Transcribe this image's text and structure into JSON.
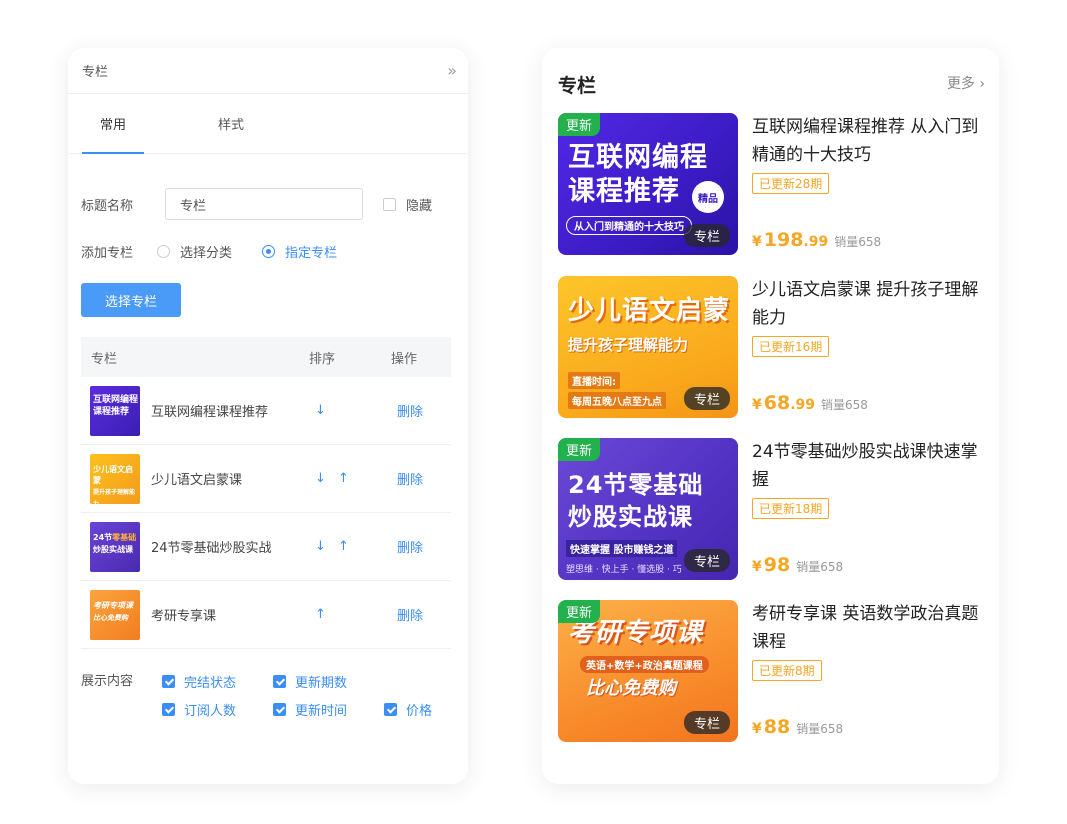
{
  "panel": {
    "title": "专栏",
    "collapse_icon": "double-chevron-right-icon",
    "tabs": [
      {
        "label": "常用",
        "active": true
      },
      {
        "label": "样式",
        "active": false
      }
    ],
    "title_field": {
      "label": "标题名称",
      "value": "专栏",
      "hide_label": "隐藏"
    },
    "add_column": {
      "label": "添加专栏",
      "options": [
        {
          "label": "选择分类",
          "selected": false
        },
        {
          "label": "指定专栏",
          "selected": true
        }
      ]
    },
    "select_button": "选择专栏",
    "table": {
      "headers": [
        "专栏",
        "排序",
        "操作"
      ],
      "rows": [
        {
          "name": "互联网编程课程推荐",
          "sort": "↓",
          "action": "删除",
          "thumb_text": "互联网编程\n课程推荐",
          "thumb_color": "#4a2bd6"
        },
        {
          "name": "少儿语文启蒙课",
          "sort": "↓ ↑",
          "action": "删除",
          "thumb_text": "少儿语文启蒙\n提升孩子理解能力",
          "thumb_color": "#f8b31a"
        },
        {
          "name": "24节零基础炒股实战",
          "sort": "↓ ↑",
          "action": "删除",
          "thumb_text": "24节零基础\n炒股实战课",
          "thumb_color": "#5a3cc7"
        },
        {
          "name": "考研专享课",
          "sort": "↑",
          "action": "删除",
          "thumb_text": "考研专项课\n比心免费购",
          "thumb_color": "#f79a2e"
        }
      ]
    },
    "display": {
      "label": "展示内容",
      "options": [
        {
          "label": "完结状态",
          "checked": true
        },
        {
          "label": "更新期数",
          "checked": true
        },
        {
          "label": "订阅人数",
          "checked": true
        },
        {
          "label": "更新时间",
          "checked": true
        },
        {
          "label": "价格",
          "checked": true
        }
      ]
    }
  },
  "preview": {
    "title": "专栏",
    "more": "更多 ›",
    "items": [
      {
        "tag_new": "更新",
        "cover_lines": [
          "互联网编程",
          "课程推荐"
        ],
        "cover_sub": "从入门到精通的十大技巧",
        "cover_badge": "精品",
        "tag_col": "专栏",
        "name": "互联网编程课程推荐 从入门到精通的十大技巧",
        "update": "已更新28期",
        "price_int": "198",
        "price_dec": ".99",
        "currency": "¥",
        "sales": "销量658"
      },
      {
        "tag_new": "",
        "cover_lines": [
          "少儿语文启蒙"
        ],
        "cover_sub": "提升孩子理解能力",
        "cover_extra_1": "直播时间:",
        "cover_extra_2": "每周五晚八点至九点",
        "tag_col": "专栏",
        "name": "少儿语文启蒙课 提升孩子理解能力",
        "update": "已更新16期",
        "price_int": "68",
        "price_dec": ".99",
        "currency": "¥",
        "sales": "销量658"
      },
      {
        "tag_new": "更新",
        "cover_lines": [
          "24节零基础",
          "炒股实战课"
        ],
        "cover_sub": "快速掌握  股市赚钱之道",
        "cover_extra_1": "塑思维 · 快上手 · 懂选股 · 巧",
        "tag_col": "专栏",
        "name": "24节零基础炒股实战课快速掌握",
        "update": "已更新18期",
        "price_int": "98",
        "price_dec": "",
        "currency": "¥",
        "sales": "销量658"
      },
      {
        "tag_new": "更新",
        "cover_lines": [
          "考研专项课"
        ],
        "cover_sub": "英语+数学+政治真题课程",
        "cover_extra_1": "比心免费购",
        "tag_col": "专栏",
        "name": "考研专享课 英语数学政治真题课程",
        "update": "已更新8期",
        "price_int": "88",
        "price_dec": "",
        "currency": "¥",
        "sales": "销量658"
      }
    ]
  }
}
